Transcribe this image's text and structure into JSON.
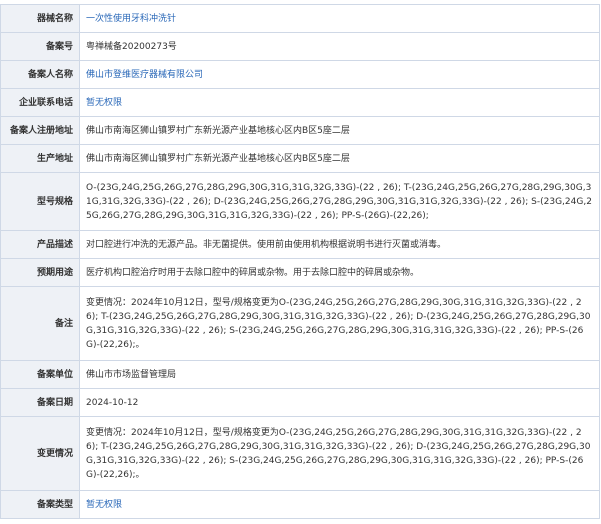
{
  "rows": [
    {
      "label": "器械名称",
      "value": "一次性使用牙科冲洗针",
      "link": true
    },
    {
      "label": "备案号",
      "value": "粤禅械备20200273号",
      "link": false
    },
    {
      "label": "备案人名称",
      "value": "佛山市登维医疗器械有限公司",
      "link": true
    },
    {
      "label": "企业联系电话",
      "value": "暂无权限",
      "link": true
    },
    {
      "label": "备案人注册地址",
      "value": "佛山市南海区狮山镇罗村广东新光源产业基地核心区内B区5座二层",
      "link": false
    },
    {
      "label": "生产地址",
      "value": "佛山市南海区狮山镇罗村广东新光源产业基地核心区内B区5座二层",
      "link": false
    },
    {
      "label": "型号规格",
      "value": "O-(23G,24G,25G,26G,27G,28G,29G,30G,31G,31G,32G,33G)-(22 , 26); T-(23G,24G,25G,26G,27G,28G,29G,30G,31G,31G,32G,33G)-(22 , 26); D-(23G,24G,25G,26G,27G,28G,29G,30G,31G,31G,32G,33G)-(22 , 26); S-(23G,24G,25G,26G,27G,28G,29G,30G,31G,31G,32G,33G)-(22 , 26); PP-S-(26G)-(22,26);",
      "link": false
    },
    {
      "label": "产品描述",
      "value": "对口腔进行冲洗的无源产品。非无菌提供。使用前由使用机构根据说明书进行灭菌或消毒。",
      "link": false
    },
    {
      "label": "预期用途",
      "value": "医疗机构口腔治疗时用于去除口腔中的碎屑或杂物。用于去除口腔中的碎屑或杂物。",
      "link": false
    },
    {
      "label": "备注",
      "value": "变更情况：2024年10月12日，型号/规格变更为O-(23G,24G,25G,26G,27G,28G,29G,30G,31G,31G,32G,33G)-(22 , 26); T-(23G,24G,25G,26G,27G,28G,29G,30G,31G,31G,32G,33G)-(22 , 26); D-(23G,24G,25G,26G,27G,28G,29G,30G,31G,31G,32G,33G)-(22 , 26); S-(23G,24G,25G,26G,27G,28G,29G,30G,31G,31G,32G,33G)-(22 , 26); PP-S-(26G)-(22,26);。",
      "link": false
    },
    {
      "label": "备案单位",
      "value": "佛山市市场监督管理局",
      "link": false
    },
    {
      "label": "备案日期",
      "value": "2024-10-12",
      "link": false
    },
    {
      "label": "变更情况",
      "value": "变更情况：2024年10月12日，型号/规格变更为O-(23G,24G,25G,26G,27G,28G,29G,30G,31G,31G,32G,33G)-(22 , 26); T-(23G,24G,25G,26G,27G,28G,29G,30G,31G,31G,32G,33G)-(22 , 26); D-(23G,24G,25G,26G,27G,28G,29G,30G,31G,31G,32G,33G)-(22 , 26); S-(23G,24G,25G,26G,27G,28G,29G,30G,31G,31G,32G,33G)-(22 , 26); PP-S-(26G)-(22,26);。",
      "link": false
    },
    {
      "label": "备案类型",
      "value": "暂无权限",
      "link": true
    }
  ]
}
